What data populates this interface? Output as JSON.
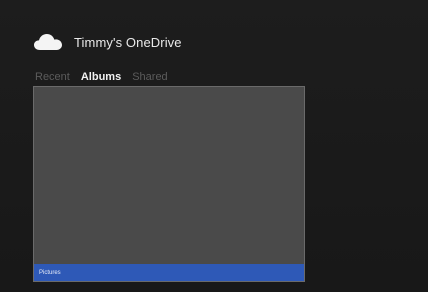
{
  "header": {
    "icon": "cloud-icon",
    "title": "Timmy's OneDrive"
  },
  "tabs": [
    {
      "label": "Recent",
      "active": false
    },
    {
      "label": "Albums",
      "active": true
    },
    {
      "label": "Shared",
      "active": false
    }
  ],
  "albums": [
    {
      "label": "Pictures"
    }
  ],
  "colors": {
    "background": "#1b1b1b",
    "tile": "#4a4a4a",
    "label_bar": "#2e59b7",
    "inactive_tab": "#5c5c5c"
  }
}
